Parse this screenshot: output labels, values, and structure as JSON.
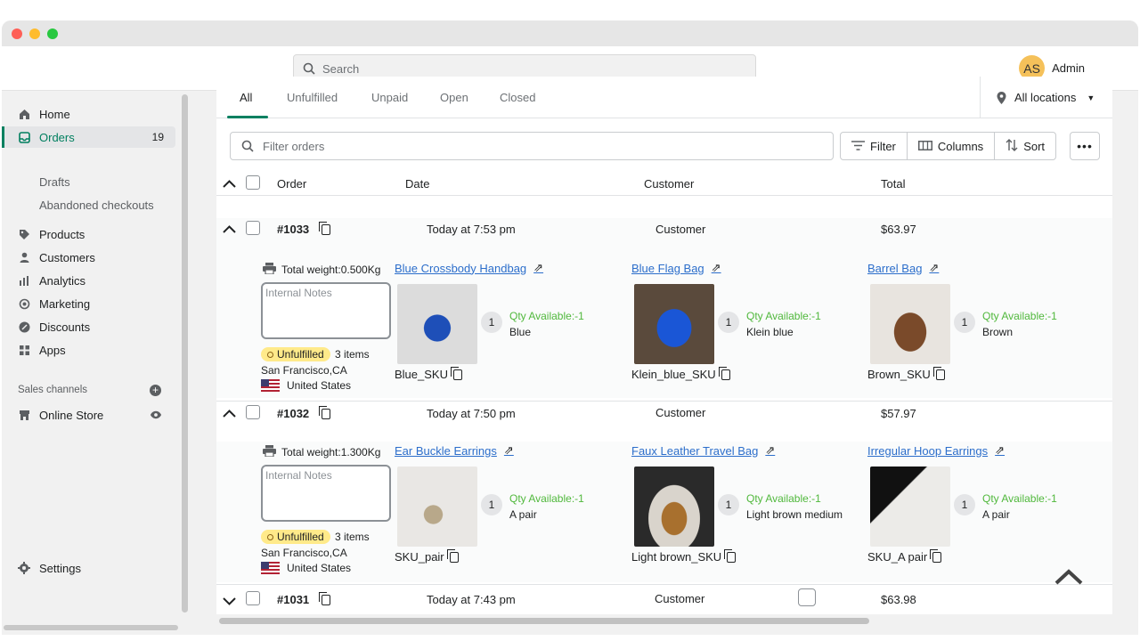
{
  "search": {
    "placeholder": "Search"
  },
  "user": {
    "initials": "AS",
    "name": "Admin"
  },
  "sidebar": {
    "items": [
      {
        "label": "Home",
        "icon": "home-icon"
      },
      {
        "label": "Orders",
        "icon": "orders-icon",
        "count": "19"
      },
      {
        "label": "Products",
        "icon": "tag-icon"
      },
      {
        "label": "Customers",
        "icon": "person-icon"
      },
      {
        "label": "Analytics",
        "icon": "bar-chart-icon"
      },
      {
        "label": "Marketing",
        "icon": "marketing-icon"
      },
      {
        "label": "Discounts",
        "icon": "discount-icon"
      },
      {
        "label": "Apps",
        "icon": "apps-icon"
      }
    ],
    "sub_items": [
      "Drafts",
      "Abandoned checkouts"
    ],
    "sales_channels_label": "Sales channels",
    "online_store": "Online Store",
    "settings": "Settings"
  },
  "tabs": [
    "All",
    "Unfulfilled",
    "Unpaid",
    "Open",
    "Closed"
  ],
  "location_label": "All locations",
  "filter": {
    "placeholder": "Filter orders",
    "filter_label": "Filter",
    "columns_label": "Columns",
    "sort_label": "Sort"
  },
  "columns": {
    "order": "Order",
    "date": "Date",
    "customer": "Customer",
    "total": "Total"
  },
  "orders": [
    {
      "number": "#1033",
      "date": "Today at 7:53 pm",
      "customer": "Customer",
      "total": "$63.97",
      "weight": "Total weight:0.500Kg",
      "notes_placeholder": "Internal Notes",
      "status": "Unfulfilled",
      "items": "3 items",
      "city": "San Francisco,CA",
      "country": "United States",
      "products": [
        {
          "title": "Blue Crossbody Handbag",
          "qty": "1",
          "available": "Qty Available:-1",
          "variant": "Blue",
          "sku": "Blue_SKU"
        },
        {
          "title": "Blue Flag Bag",
          "qty": "1",
          "available": "Qty Available:-1",
          "variant": "Klein blue",
          "sku": "Klein_blue_SKU"
        },
        {
          "title": "Barrel Bag",
          "qty": "1",
          "available": "Qty Available:-1",
          "variant": "Brown",
          "sku": "Brown_SKU"
        }
      ]
    },
    {
      "number": "#1032",
      "date": "Today at 7:50 pm",
      "customer": "Customer",
      "total": "$57.97",
      "weight": "Total weight:1.300Kg",
      "notes_placeholder": "Internal Notes",
      "status": "Unfulfilled",
      "items": "3 items",
      "city": "San Francisco,CA",
      "country": "United States",
      "products": [
        {
          "title": "Ear Buckle Earrings",
          "qty": "1",
          "available": "Qty Available:-1",
          "variant": "A pair",
          "sku": "SKU_pair"
        },
        {
          "title": "Faux Leather Travel Bag",
          "qty": "1",
          "available": "Qty Available:-1",
          "variant": "Light brown medium",
          "sku": "Light brown_SKU"
        },
        {
          "title": "Irregular Hoop Earrings",
          "qty": "1",
          "available": "Qty Available:-1",
          "variant": "A pair",
          "sku": "SKU_A pair"
        }
      ]
    },
    {
      "number": "#1031",
      "date": "Today at 7:43 pm",
      "customer": "Customer",
      "total": "$63.98"
    }
  ]
}
